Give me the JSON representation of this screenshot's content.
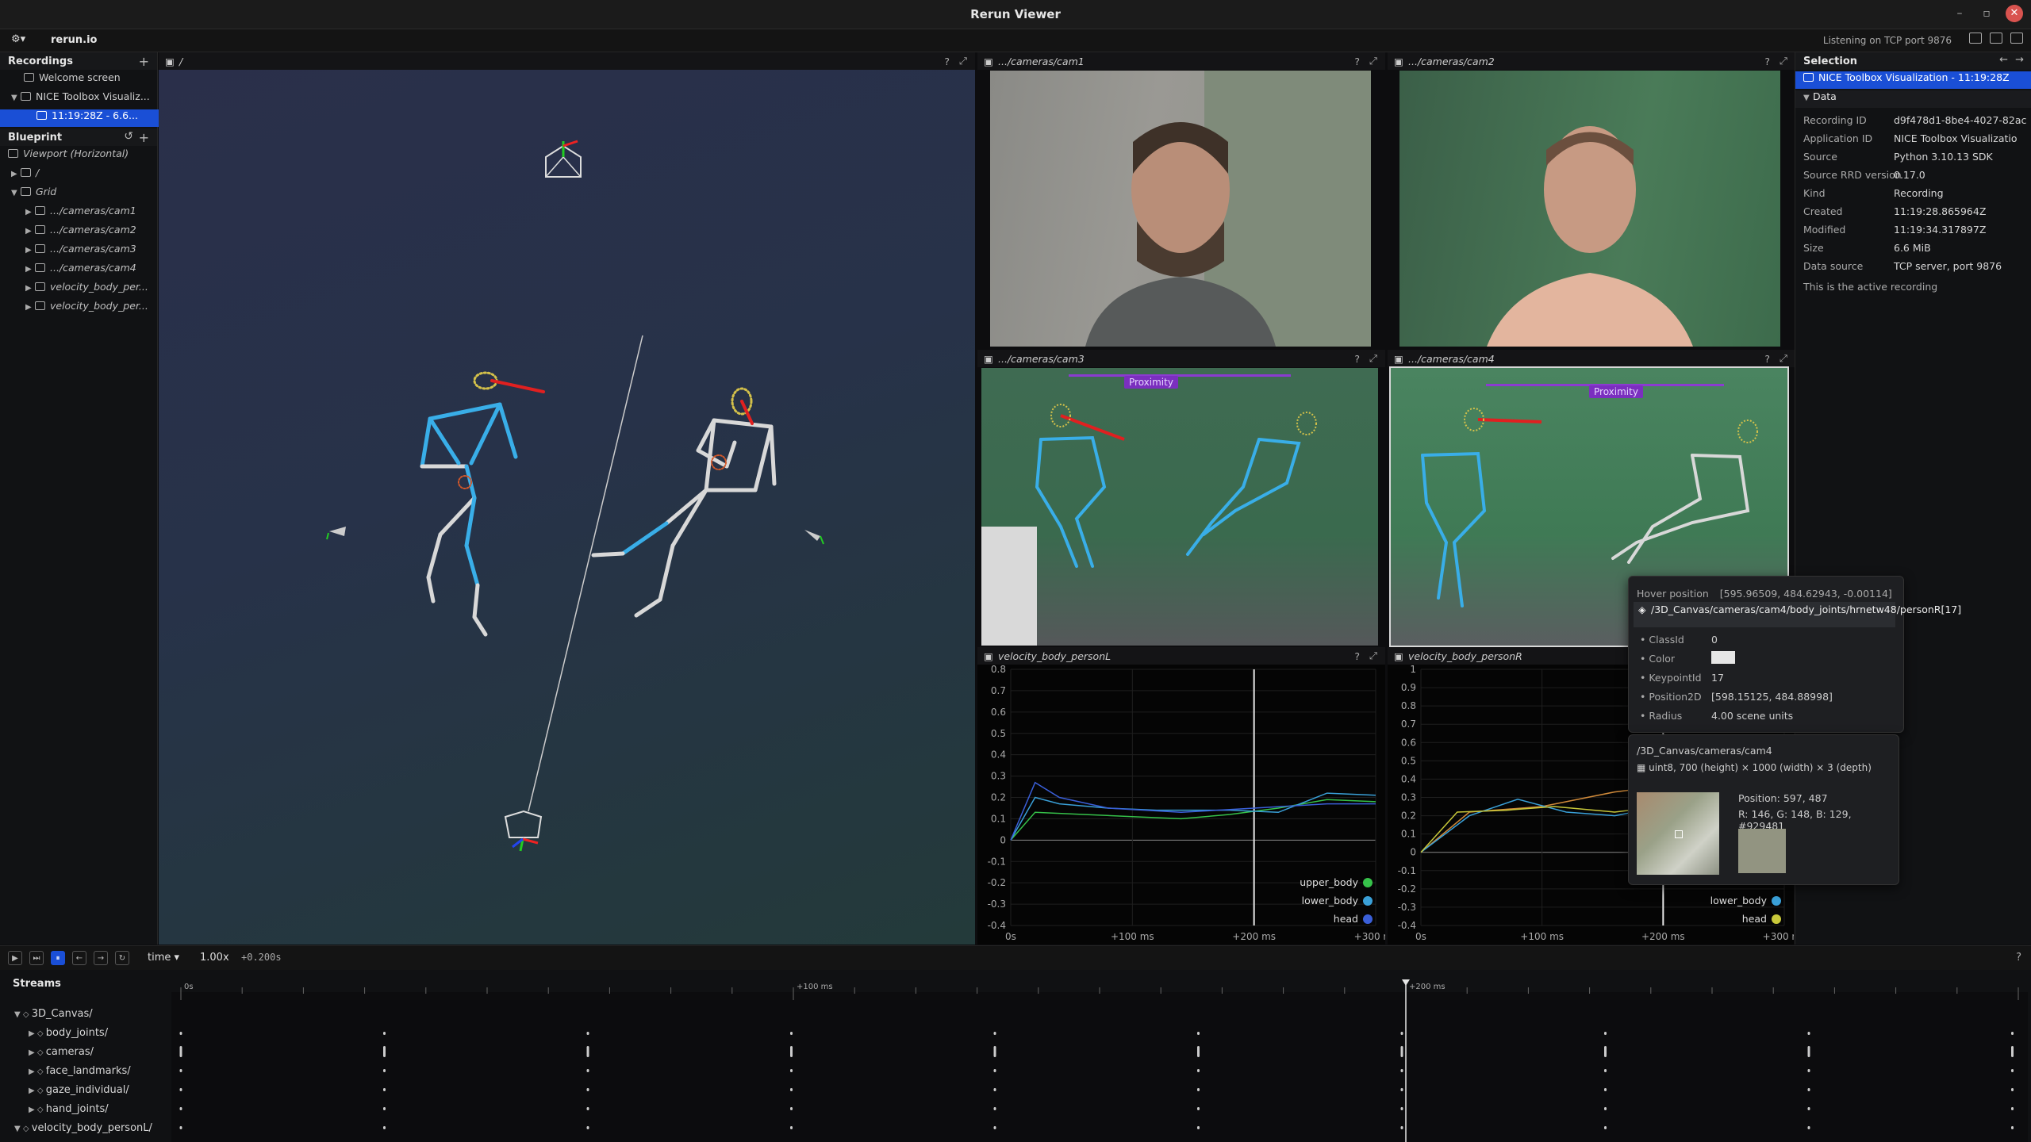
{
  "window": {
    "title": "Rerun Viewer"
  },
  "topbar": {
    "brand": "rerun.io",
    "status": "Listening on TCP port 9876"
  },
  "recordings": {
    "header": "Recordings",
    "items": [
      {
        "label": "Welcome screen"
      },
      {
        "label": "NICE Toolbox Visualiz..."
      },
      {
        "label": "11:19:28Z - 6.6..."
      }
    ]
  },
  "blueprint": {
    "header": "Blueprint",
    "items": [
      {
        "label": "Viewport (Horizontal)"
      },
      {
        "label": "/"
      },
      {
        "label": "Grid"
      },
      {
        "label": ".../cameras/cam1"
      },
      {
        "label": ".../cameras/cam2"
      },
      {
        "label": ".../cameras/cam3"
      },
      {
        "label": ".../cameras/cam4"
      },
      {
        "label": "velocity_body_per..."
      },
      {
        "label": "velocity_body_per..."
      }
    ]
  },
  "views": {
    "root": "/",
    "cam1": ".../cameras/cam1",
    "cam2": ".../cameras/cam2",
    "cam3": ".../cameras/cam3",
    "cam4": ".../cameras/cam4",
    "plotL": "velocity_body_personL",
    "plotR": "velocity_body_personR",
    "proximity": "Proximity",
    "help": "?"
  },
  "plots": {
    "yticks_left": [
      "0.8",
      "0.7",
      "0.6",
      "0.5",
      "0.4",
      "0.3",
      "0.2",
      "0.1",
      "0",
      "-0.1",
      "-0.2",
      "-0.3",
      "-0.4"
    ],
    "yticks_right": [
      "1",
      "0.9",
      "0.8",
      "0.7",
      "0.6",
      "0.5",
      "0.4",
      "0.3",
      "0.2",
      "0.1",
      "0",
      "-0.1",
      "-0.2",
      "-0.3",
      "-0.4"
    ],
    "xticks": [
      "0s",
      "+100 ms",
      "+200 ms",
      "+300 ms"
    ],
    "legend": [
      {
        "name": "upper_body",
        "color": "#36c24a"
      },
      {
        "name": "lower_body",
        "color": "#3aa0d8"
      },
      {
        "name": "head",
        "color": "#3a5fd8"
      }
    ],
    "legend_right": [
      {
        "name": "upper_body",
        "color": "#d08a3a"
      },
      {
        "name": "lower_body",
        "color": "#3aa0d8"
      },
      {
        "name": "head",
        "color": "#c8c83a"
      }
    ]
  },
  "selection": {
    "header": "Selection",
    "item": "NICE Toolbox Visualization - 11:19:28Z",
    "section": "Data",
    "fields": [
      {
        "k": "Recording ID",
        "v": "d9f478d1-8be4-4027-82ac"
      },
      {
        "k": "Application ID",
        "v": "NICE Toolbox Visualizatio"
      },
      {
        "k": "Source",
        "v": "Python 3.10.13 SDK"
      },
      {
        "k": "Source RRD version",
        "v": "0.17.0"
      },
      {
        "k": "Kind",
        "v": "Recording"
      },
      {
        "k": "Created",
        "v": "11:19:28.865964Z"
      },
      {
        "k": "Modified",
        "v": "11:19:34.317897Z"
      },
      {
        "k": "Size",
        "v": "6.6 MiB"
      },
      {
        "k": "Data source",
        "v": "TCP server, port 9876"
      }
    ],
    "note": "This is the active recording"
  },
  "hover": {
    "title": "Hover position",
    "position": "[595.96509, 484.62943, -0.00114]",
    "path": "/3D_Canvas/cameras/cam4/body_joints/hrnetw48/personR[17]",
    "fields": [
      {
        "k": "ClassId",
        "v": "0"
      },
      {
        "k": "Color",
        "v": ""
      },
      {
        "k": "KeypointId",
        "v": "17"
      },
      {
        "k": "Position2D",
        "v": "[598.15125, 484.88998]"
      },
      {
        "k": "Radius",
        "v": "4.00   scene units"
      }
    ],
    "color_swatch": "#e6e6e6"
  },
  "image_tip": {
    "path": "/3D_Canvas/cameras/cam4",
    "desc": "uint8, 700 (height) × 1000 (width) × 3 (depth)",
    "position": "Position:  597, 487",
    "rgb": "R: 146, G: 148, B: 129, #929481",
    "swatch": "#929481"
  },
  "timeline": {
    "timeline_name": "time",
    "speed": "1.00x",
    "offset": "+0.200s",
    "help": "?",
    "ticks": [
      "0s",
      "+100 ms",
      "+200 ms"
    ]
  },
  "streams": {
    "header": "Streams",
    "items": [
      {
        "label": "3D_Canvas/",
        "indent": 1,
        "open": true
      },
      {
        "label": "body_joints/",
        "indent": 2,
        "open": false
      },
      {
        "label": "cameras/",
        "indent": 2,
        "open": false
      },
      {
        "label": "face_landmarks/",
        "indent": 2,
        "open": false
      },
      {
        "label": "gaze_individual/",
        "indent": 2,
        "open": false
      },
      {
        "label": "hand_joints/",
        "indent": 2,
        "open": false
      },
      {
        "label": "velocity_body_personL/",
        "indent": 1,
        "open": true
      }
    ]
  },
  "colors": {
    "accent": "#1a4fd6",
    "joint_blue": "#39aee8",
    "bone_white": "#d8d8d8",
    "gaze_red": "#e02020"
  }
}
